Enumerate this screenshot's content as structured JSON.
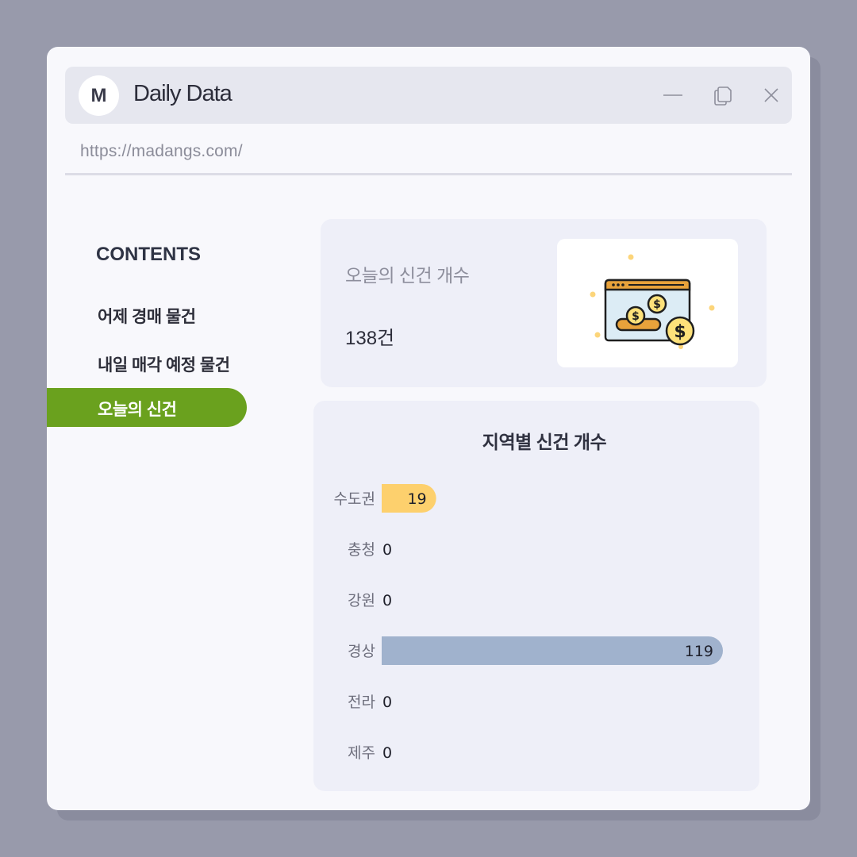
{
  "app": {
    "logo_letter": "M",
    "title": "Daily Data",
    "url": "https://madangs.com/"
  },
  "window_controls": {
    "minimize": "minimize-icon",
    "restore": "restore-icon",
    "close": "close-icon"
  },
  "sidebar": {
    "title": "CONTENTS",
    "items": [
      {
        "label": "어제 경매 물건",
        "active": false
      },
      {
        "label": "내일 매각 예정 물건",
        "active": false
      },
      {
        "label": "오늘의 신건",
        "active": true
      }
    ]
  },
  "summary_card": {
    "label": "오늘의 신건 개수",
    "value": "138건",
    "illustration": "coin-browser-icon"
  },
  "chart_data": {
    "type": "bar",
    "orientation": "horizontal",
    "title": "지역별 신건 개수",
    "categories": [
      "수도권",
      "충청",
      "강원",
      "경상",
      "전라",
      "제주"
    ],
    "values": [
      19,
      0,
      0,
      119,
      0,
      0
    ],
    "bar_colors": [
      "#fdd06d",
      "#a0b2cd",
      "#a0b2cd",
      "#a0b2cd",
      "#a0b2cd",
      "#a0b2cd"
    ],
    "xlim": [
      0,
      119
    ],
    "grid": false
  },
  "colors": {
    "accent": "#6aa11e",
    "background": "#989aab",
    "card": "#eeeff8"
  }
}
